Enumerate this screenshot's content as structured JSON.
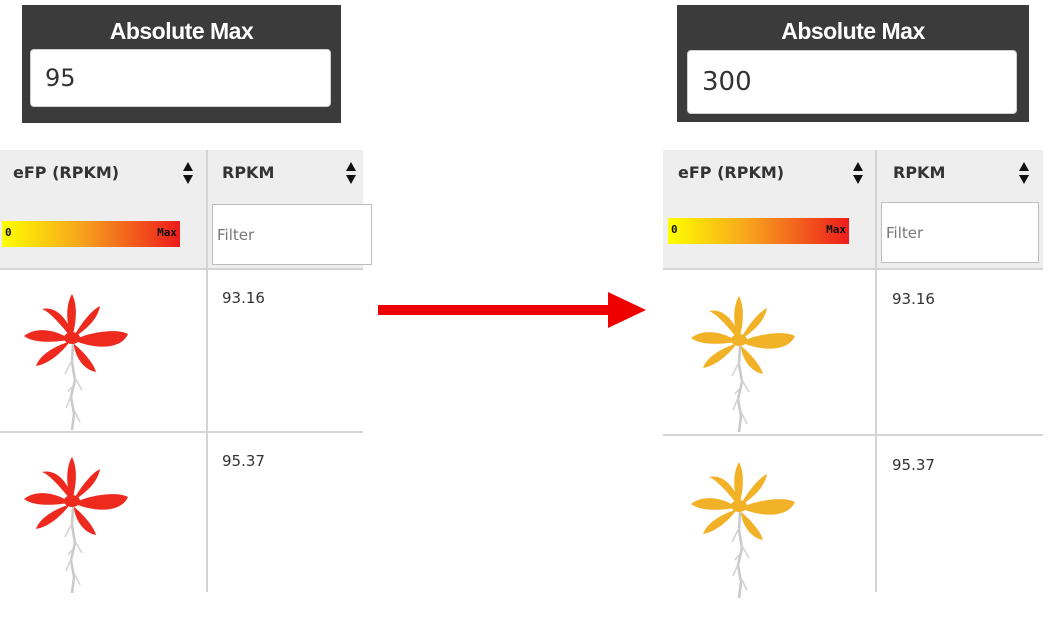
{
  "left": {
    "absolute_max_title": "Absolute Max",
    "absolute_max_value": "95",
    "columns": [
      {
        "label": "eFP (RPKM)"
      },
      {
        "label": "RPKM"
      }
    ],
    "legend": {
      "min": "0",
      "max": "Max"
    },
    "filter_placeholder": "Filter",
    "rows": [
      {
        "value": "93.16"
      },
      {
        "value": "95.37"
      }
    ],
    "plant_color": "#ee2a1f"
  },
  "right": {
    "absolute_max_title": "Absolute Max",
    "absolute_max_value": "300",
    "columns": [
      {
        "label": "eFP (RPKM)"
      },
      {
        "label": "RPKM"
      }
    ],
    "legend": {
      "min": "0",
      "max": "Max"
    },
    "filter_placeholder": "Filter",
    "rows": [
      {
        "value": "93.16"
      },
      {
        "value": "95.37"
      }
    ],
    "plant_color": "#f2b227"
  },
  "arrow_color": "#ee0000"
}
